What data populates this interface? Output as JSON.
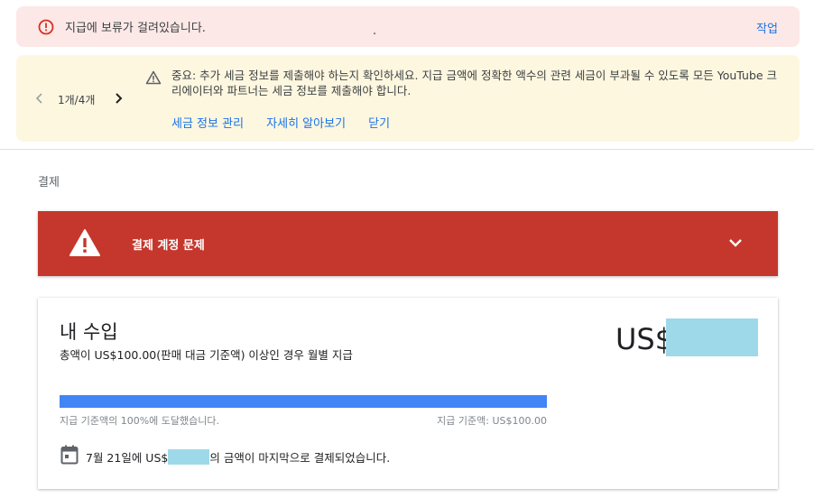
{
  "hold_banner": {
    "message": "지급에 보류가 걸려있습니다.",
    "dot": ".",
    "action_label": "작업"
  },
  "tax_banner": {
    "pager_text": "1개/4개",
    "message": "중요: 추가 세금 정보를 제출해야 하는지 확인하세요. 지급 금액에 정확한 액수의 관련 세금이 부과될 수 있도록 모든 YouTube 크리에이터와 파트너는 세금 정보를 제출해야 합니다.",
    "links": [
      "세금 정보 관리",
      "자세히 알아보기",
      "닫기"
    ]
  },
  "section": {
    "label": "결제"
  },
  "alert": {
    "title": "결제 계정 문제"
  },
  "earnings": {
    "title": "내 수입",
    "subtitle": "총액이 US$100.00(판매 대금 기준액) 이상인 경우 월별 지급",
    "currency": "US$",
    "progress": {
      "percent": 100,
      "status_text": "지급 기준액의 100%에 도달했습니다.",
      "threshold_text": "지급 기준액: US$100.00"
    },
    "last_payment": {
      "prefix": "7월 21일에 US$",
      "suffix": "의 금액이 마지막으로 결제되었습니다."
    }
  },
  "colors": {
    "hold_bg": "#fce8e6",
    "tax_bg": "#fef7e0",
    "alert_bg": "#c5372c",
    "link": "#1a73e8",
    "progress": "#4285f4",
    "redaction": "#9ed9ea"
  },
  "icons": {
    "hold": "error-circle-icon",
    "tax_warning": "warning-triangle-icon",
    "pager_prev": "chevron-left-icon",
    "pager_next": "chevron-right-icon",
    "alert": "warning-filled-icon",
    "alert_expand": "chevron-down-icon",
    "calendar": "calendar-icon"
  }
}
